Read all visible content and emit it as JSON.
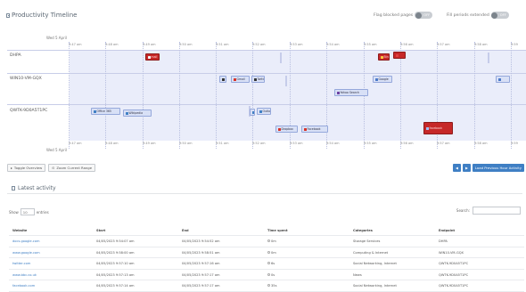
{
  "header": {
    "title": "Productivity Timeline",
    "flag_label": "Flag blocked pages",
    "flag_state": "OFF",
    "extend_label": "Fill periods extended",
    "extend_state": "OFF"
  },
  "timeline": {
    "date": "Wed 5 April",
    "ticks": [
      "9:47 am",
      "9:48 am",
      "9:49 am",
      "9:50 am",
      "9:51 am",
      "9:52 am",
      "9:53 am",
      "9:54 am",
      "9:55 am",
      "9:56 am",
      "9:57 am",
      "9:58 am",
      "9:59"
    ],
    "bands": [
      {
        "label": "DHPA"
      },
      {
        "label": "WIN10-VM-GQX"
      },
      {
        "label": "QWTK-9D0A5T1PC"
      }
    ],
    "items": [
      {
        "label": "mail",
        "icon": "page-icon",
        "color": "red",
        "icon_color": "#f2f2f2"
      },
      {
        "label": "Bing",
        "icon": "star-icon",
        "color": "red",
        "icon_color": "#f5c842"
      },
      {
        "label": "",
        "icon": "page-icon",
        "color": "red",
        "icon_color": "#e04040"
      },
      {
        "label": "",
        "icon": "page-icon",
        "color": "blue",
        "icon_color": "#333333"
      },
      {
        "label": "Gmail",
        "icon": "mail-icon",
        "color": "blue",
        "icon_color": "#d93025"
      },
      {
        "label": "Twitter",
        "icon": "page-icon",
        "color": "blue",
        "icon_color": "#333333"
      },
      {
        "label": "Google",
        "icon": "page-icon",
        "color": "blue",
        "icon_color": "#4a79c8"
      },
      {
        "label": "",
        "icon": "page-icon",
        "color": "blue",
        "icon_color": "#4a79c8"
      },
      {
        "label": "Yahoo Search",
        "icon": "page-icon",
        "color": "blue",
        "icon_color": "#6b3fa0"
      },
      {
        "label": "Office 365",
        "icon": "page-icon",
        "color": "blue",
        "icon_color": "#3f7fc4"
      },
      {
        "label": "Wikipedia",
        "icon": "page-icon",
        "color": "blue",
        "icon_color": "#3f7fc4"
      },
      {
        "label": "",
        "icon": "page-icon",
        "color": "blue",
        "icon_color": "#3f7fc4"
      },
      {
        "label": "Outlook",
        "icon": "page-icon",
        "color": "blue",
        "icon_color": "#3f7fc4"
      },
      {
        "label": "Dropbox",
        "icon": "heart-icon",
        "color": "blue",
        "icon_color": "#d93025"
      },
      {
        "label": "Facebook",
        "icon": "heart-icon",
        "color": "blue",
        "icon_color": "#d93025"
      },
      {
        "label": "facebook",
        "icon": "page-icon",
        "color": "red",
        "icon_color": "#9ec3ff"
      }
    ]
  },
  "actions": {
    "toggle_view": "Toggle Overview",
    "zoom_range": "Zoom Current Range",
    "prev": "◀",
    "next": "▶",
    "load": "Load Previous Hour Activity"
  },
  "activity": {
    "title": "Latest activity",
    "show_label": "Show",
    "entries_value": "10",
    "entries_suffix": "entries",
    "search_label": "Search:",
    "search_placeholder": "",
    "columns": [
      "Website",
      "Start",
      "End",
      "Time spent",
      "Categories",
      "Endpoint"
    ],
    "rows": [
      {
        "website": "docs.google.com",
        "start": "04/05/2023 9:54:07 am",
        "end": "04/05/2023 9:54:52 am",
        "time": "0m",
        "category": "Storage Services",
        "endpoint": "DHPA"
      },
      {
        "website": "www.google.com",
        "start": "04/05/2023 9:58:00 am",
        "end": "04/05/2023 9:58:51 am",
        "time": "0m",
        "category": "Computing & Internet",
        "endpoint": "WIN10-VM-GQX"
      },
      {
        "website": "twitter.com",
        "start": "04/05/2023 9:57:10 am",
        "end": "04/05/2023 9:57:16 am",
        "time": "6s",
        "category": "Social Networking, Internet",
        "endpoint": "QWTK-9D0A5T1PC"
      },
      {
        "website": "www.bbc.co.uk",
        "start": "04/05/2023 9:57:13 am",
        "end": "04/05/2023 9:57:17 am",
        "time": "0s",
        "category": "News",
        "endpoint": "QWTK-9D0A5T1PC"
      },
      {
        "website": "facebook.com",
        "start": "04/05/2023 9:57:14 am",
        "end": "04/05/2023 9:57:17 am",
        "time": "35s",
        "category": "Social Networking, Internet",
        "endpoint": "QWTK-9D0A5T1PC"
      }
    ]
  }
}
